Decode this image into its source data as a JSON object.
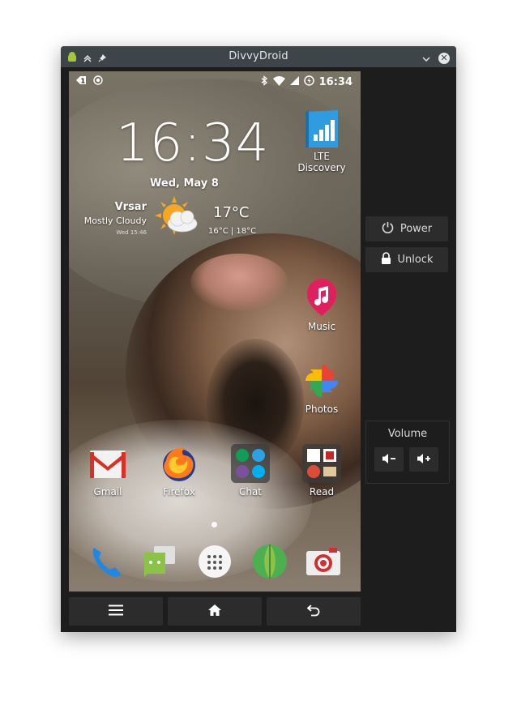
{
  "window": {
    "title": "DivvyDroid"
  },
  "status_bar": {
    "time": "16:34",
    "notification_badge": "1"
  },
  "clock_widget": {
    "time": "16:34",
    "date": "Wed, May 8"
  },
  "weather": {
    "city": "Vrsar",
    "condition": "Mostly Cloudy",
    "updated": "Wed 15:46",
    "temperature": "17°C",
    "range": "16°C | 18°C"
  },
  "home_apps": {
    "lte_discovery": "LTE Discovery",
    "music": "Music",
    "photos": "Photos",
    "gmail": "Gmail",
    "firefox": "Firefox",
    "chat": "Chat",
    "read": "Read"
  },
  "dock": [
    "phone-icon",
    "messages-icon",
    "app-drawer-icon",
    "melon-icon",
    "camera-icon"
  ],
  "controls": {
    "power": "Power",
    "unlock": "Unlock",
    "volume": "Volume"
  },
  "colors": {
    "window_bg": "#1d1d1d",
    "titlebar": "#3d4549",
    "button_bg": "#2c2c2c"
  }
}
